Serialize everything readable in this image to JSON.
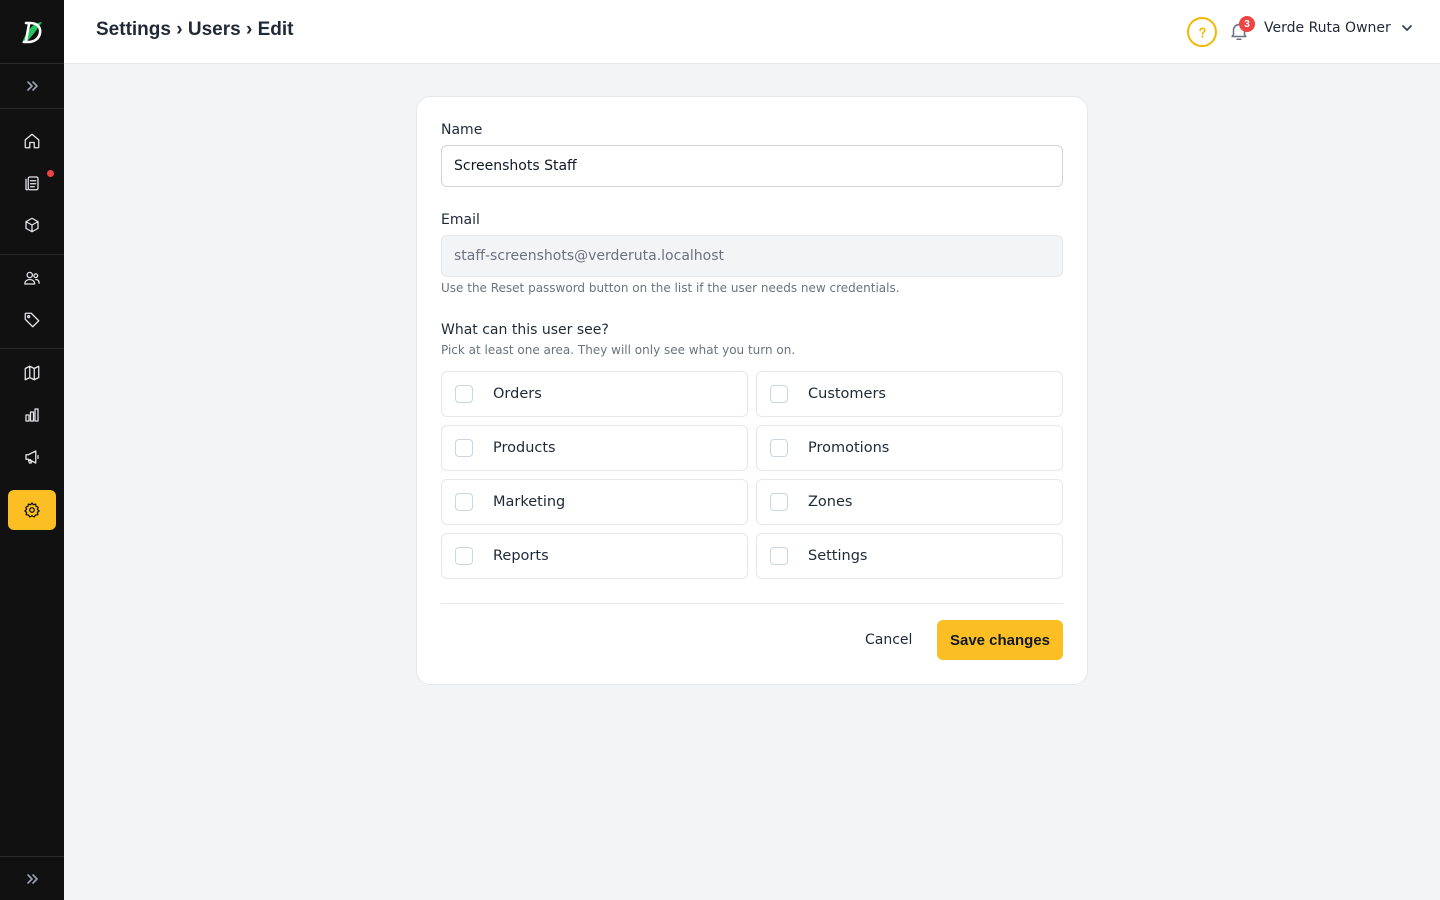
{
  "app": {
    "brand_color": "#fbbf24",
    "sidebar_bg": "#111111"
  },
  "header": {
    "breadcrumb": [
      "Settings",
      "Users",
      "Edit"
    ],
    "breadcrumb_separator": "›",
    "help_icon": "help-circle-icon",
    "notifications": {
      "icon": "bell-icon",
      "count": "3"
    },
    "user": {
      "name": "Verde Ruta Owner",
      "icon": "chevron-down-icon"
    }
  },
  "sidebar": {
    "logo": "app-logo",
    "expand_icon": "chevrons-right-icon",
    "items": [
      {
        "name": "home",
        "icon": "home-icon",
        "active": false
      },
      {
        "name": "orders",
        "icon": "clipboard-icon",
        "active": false,
        "has_dot": true
      },
      {
        "name": "products",
        "icon": "box-icon",
        "active": false
      },
      {
        "name": "customers",
        "icon": "users-icon",
        "active": false
      },
      {
        "name": "promotions",
        "icon": "tag-icon",
        "active": false
      },
      {
        "name": "zones",
        "icon": "map-icon",
        "active": false
      },
      {
        "name": "reports",
        "icon": "bar-chart-icon",
        "active": false
      },
      {
        "name": "marketing",
        "icon": "megaphone-icon",
        "active": false
      },
      {
        "name": "settings",
        "icon": "gear-icon",
        "active": true
      }
    ]
  },
  "form": {
    "name_label": "Name",
    "name_value": "Screenshots Staff",
    "email_label": "Email",
    "email_value": "staff-screenshots@verderuta.localhost",
    "email_hint": "Use the Reset password button on the list if the user needs new credentials.",
    "permissions_title": "What can this user see?",
    "permissions_subtitle": "Pick at least one area. They will only see what you turn on.",
    "permissions": [
      {
        "label": "Orders",
        "checked": false
      },
      {
        "label": "Customers",
        "checked": false
      },
      {
        "label": "Products",
        "checked": false
      },
      {
        "label": "Promotions",
        "checked": false
      },
      {
        "label": "Marketing",
        "checked": false
      },
      {
        "label": "Zones",
        "checked": false
      },
      {
        "label": "Reports",
        "checked": false
      },
      {
        "label": "Settings",
        "checked": false
      }
    ],
    "cancel_label": "Cancel",
    "save_label": "Save changes"
  }
}
